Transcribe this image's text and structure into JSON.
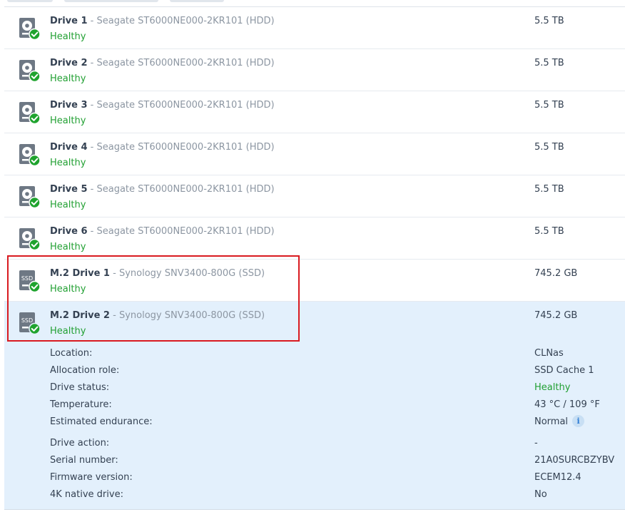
{
  "drives": [
    {
      "name": "Drive 1",
      "model": "Seagate ST6000NE000-2KR101 (HDD)",
      "status": "Healthy",
      "capacity": "5.5 TB",
      "type": "hdd",
      "icon": "hdd-healthy-icon"
    },
    {
      "name": "Drive 2",
      "model": "Seagate ST6000NE000-2KR101 (HDD)",
      "status": "Healthy",
      "capacity": "5.5 TB",
      "type": "hdd",
      "icon": "hdd-healthy-icon"
    },
    {
      "name": "Drive 3",
      "model": "Seagate ST6000NE000-2KR101 (HDD)",
      "status": "Healthy",
      "capacity": "5.5 TB",
      "type": "hdd",
      "icon": "hdd-healthy-icon"
    },
    {
      "name": "Drive 4",
      "model": "Seagate ST6000NE000-2KR101 (HDD)",
      "status": "Healthy",
      "capacity": "5.5 TB",
      "type": "hdd",
      "icon": "hdd-healthy-icon"
    },
    {
      "name": "Drive 5",
      "model": "Seagate ST6000NE000-2KR101 (HDD)",
      "status": "Healthy",
      "capacity": "5.5 TB",
      "type": "hdd",
      "icon": "hdd-healthy-icon"
    },
    {
      "name": "Drive 6",
      "model": "Seagate ST6000NE000-2KR101 (HDD)",
      "status": "Healthy",
      "capacity": "5.5 TB",
      "type": "hdd",
      "icon": "hdd-healthy-icon"
    },
    {
      "name": "M.2 Drive 1",
      "model": "Synology SNV3400-800G (SSD)",
      "status": "Healthy",
      "capacity": "745.2 GB",
      "type": "ssd",
      "icon": "ssd-healthy-icon"
    },
    {
      "name": "M.2 Drive 2",
      "model": "Synology SNV3400-800G (SSD)",
      "status": "Healthy",
      "capacity": "745.2 GB",
      "type": "ssd",
      "icon": "ssd-healthy-icon",
      "selected": true
    }
  ],
  "model_separator": " - ",
  "ssd_icon_text": "SSD",
  "details": {
    "location": {
      "label": "Location:",
      "value": "CLNas"
    },
    "allocation_role": {
      "label": "Allocation role:",
      "value": "SSD Cache 1"
    },
    "drive_status": {
      "label": "Drive status:",
      "value": "Healthy"
    },
    "temperature": {
      "label": "Temperature:",
      "value": "43 °C / 109 °F"
    },
    "estimated_endurance": {
      "label": "Estimated endurance:",
      "value": "Normal"
    },
    "drive_action": {
      "label": "Drive action:",
      "value": "-"
    },
    "serial_number": {
      "label": "Serial number:",
      "value": "21A0SURCBZYBV"
    },
    "firmware_version": {
      "label": "Firmware version:",
      "value": "ECEM12.4"
    },
    "native_4k": {
      "label": "4K native drive:",
      "value": "No"
    }
  },
  "info_icon_glyph": "i",
  "colors": {
    "healthy": "#22a033",
    "selected_row": "#e3f0fc",
    "highlight": "#d91a20",
    "icon_gray": "#6e7884",
    "check_green": "#1fa32e"
  }
}
